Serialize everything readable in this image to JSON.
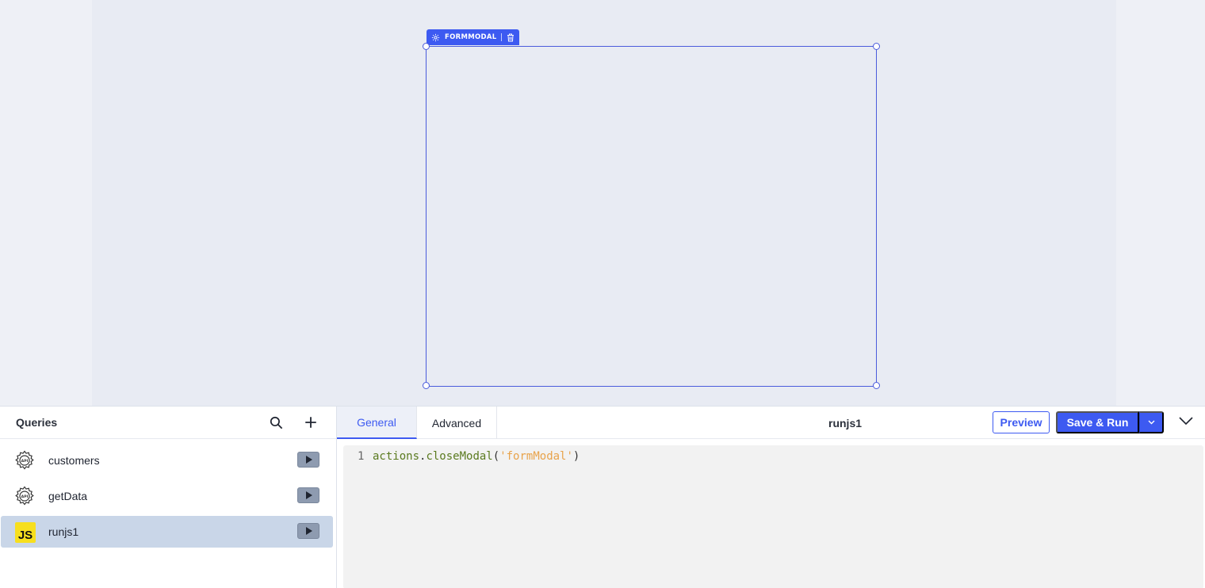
{
  "canvas": {
    "widget_tag_label": "FORMMODAL"
  },
  "queries_panel": {
    "title": "Queries",
    "items": [
      {
        "name": "customers",
        "icon": "api-gear-icon",
        "active": false
      },
      {
        "name": "getData",
        "icon": "api-gear-icon",
        "active": false
      },
      {
        "name": "runjs1",
        "icon": "js-icon",
        "active": true
      }
    ],
    "js_badge_text": "JS"
  },
  "editor": {
    "tabs": [
      {
        "label": "General",
        "active": true
      },
      {
        "label": "Advanced",
        "active": false
      }
    ],
    "query_name": "runjs1",
    "preview_label": "Preview",
    "save_run_label": "Save & Run",
    "code": {
      "line_number": "1",
      "tokens": {
        "obj": "actions",
        "dot": ".",
        "method": "closeModal",
        "open": "(",
        "arg": "'formModal'",
        "close": ")"
      }
    }
  },
  "colors": {
    "accent": "#3d5af1",
    "active_row": "#c9d6e8",
    "js_yellow": "#f7df1e"
  }
}
